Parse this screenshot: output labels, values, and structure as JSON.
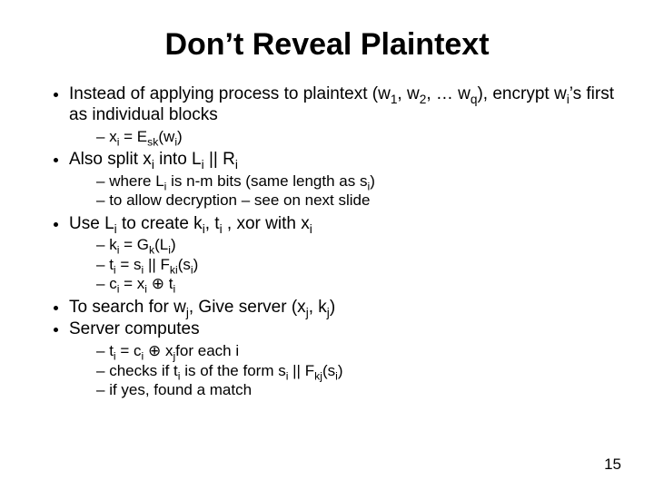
{
  "title": "Don’t Reveal Plaintext",
  "b1": "Instead of applying process to plaintext (w<sub>1</sub>, w<sub>2</sub>, … w<sub>q</sub>), encrypt w<sub>i</sub>’s first as individual blocks",
  "b1s1": "x<sub>i</sub> = E<sub>sk</sub>(w<sub>i</sub>)",
  "b2": "Also split x<sub>i</sub> into L<sub>i</sub> || R<sub>i</sub>",
  "b2s1": "where L<sub>i</sub> is n-m bits (same length as s<sub>i</sub>)",
  "b2s2": "to allow decryption – see on next slide",
  "b3": "Use L<sub>i</sub> to create k<sub>i</sub>, t<sub>i</sub> , xor with x<sub>i</sub>",
  "b3s1": "k<sub>i</sub> = G<sub>k</sub>(L<sub>i</sub>)",
  "b3s2": "t<sub>i</sub> = s<sub>i</sub> || F<sub>ki</sub>(s<sub>i</sub>)",
  "b3s3": "c<sub>i</sub> = x<sub>i</sub> <span class='xor'>⊕</span> t<sub>i</sub>",
  "b4": "To search for w<sub>j</sub>, Give server (x<sub>j</sub>, k<sub>j</sub>)",
  "b5": "Server computes",
  "b5s1": "t<sub>i</sub>  = c<sub>i</sub> <span class='xor'>⊕</span> x<sub>j</sub>for each i",
  "b5s2": "checks if t<sub>i</sub> is of the form s<sub>i</sub> || F<sub>kj</sub>(s<sub>i</sub>)",
  "b5s3": "if yes, found a match",
  "pagenum": "15"
}
